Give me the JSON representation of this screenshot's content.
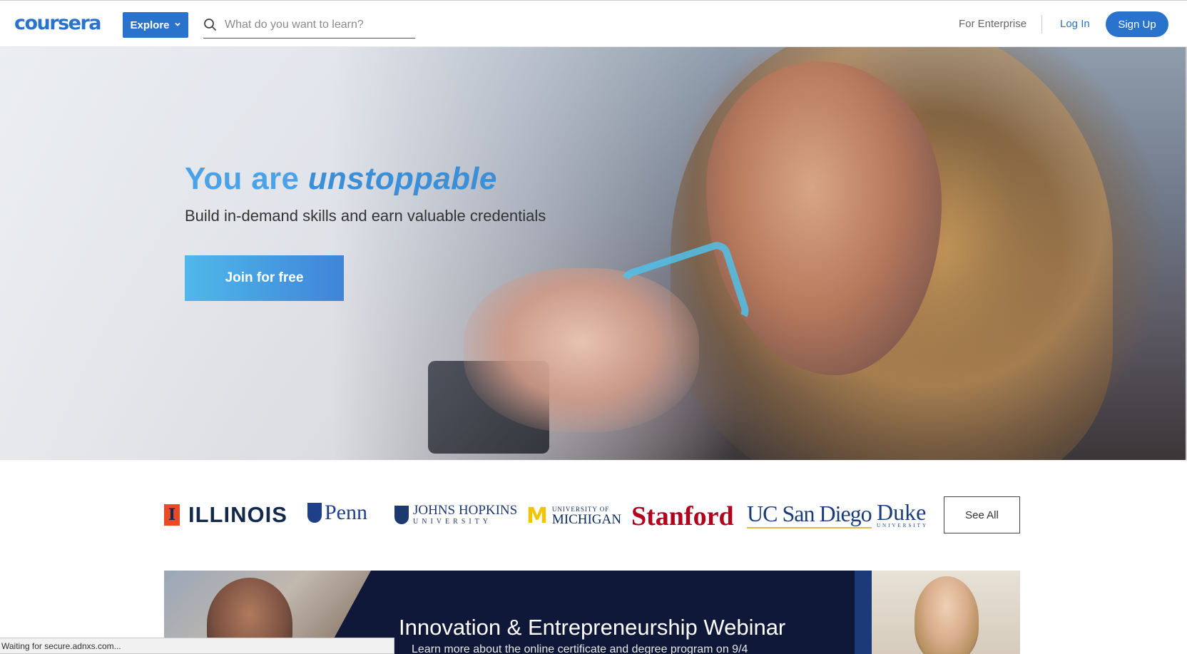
{
  "header": {
    "logo": "coursera",
    "explore_label": "Explore",
    "search_placeholder": "What do you want to learn?",
    "enterprise_label": "For Enterprise",
    "login_label": "Log In",
    "signup_label": "Sign Up"
  },
  "hero": {
    "title_prefix": "You are ",
    "title_emphasis": "unstoppable",
    "subtitle": "Build in-demand skills and earn valuable credentials",
    "cta_label": "Join for free"
  },
  "partners": {
    "illinois": "ILLINOIS",
    "penn": "Penn",
    "jhu_name": "JOHNS HOPKINS",
    "jhu_sub": "UNIVERSITY",
    "michigan_top": "UNIVERSITY OF",
    "michigan_name": "MICHIGAN",
    "stanford": "Stanford",
    "ucsd": "UC San Diego",
    "duke": "Duke",
    "duke_sub": "UNIVERSITY",
    "see_all_label": "See All"
  },
  "webinar": {
    "title": "Innovation & Entrepreneurship Webinar",
    "subtitle": "Learn more about the online certificate and degree program on 9/4"
  },
  "status_bar": {
    "text": "Waiting for secure.adnxs.com..."
  },
  "colors": {
    "brand_blue": "#2a73cc",
    "hero_title": "#4aa3e6",
    "webinar_bg": "#0f1838"
  },
  "icons": {
    "search": "search-icon",
    "explore_chevron": "chevron-down-icon"
  }
}
